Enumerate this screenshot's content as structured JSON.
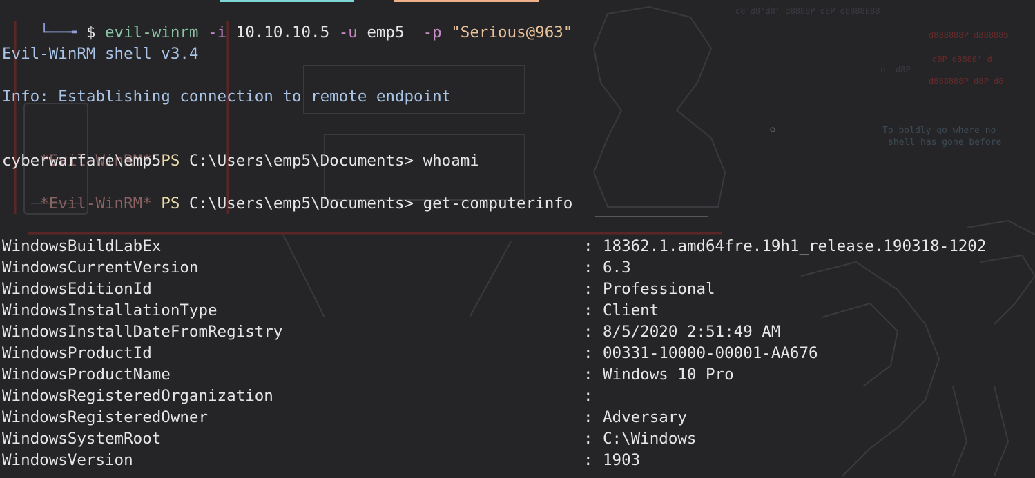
{
  "command_line": {
    "prompt_art": "└──╼",
    "dollar": "$",
    "program": "evil-winrm",
    "flag_i": "-i",
    "ip": "10.10.10.5",
    "flag_u": "-u",
    "user": "emp5",
    "flag_p": "-p",
    "password": "\"Serious@963\""
  },
  "banner": "Evil-WinRM shell v3.4",
  "info": "Info: Establishing connection to remote endpoint",
  "session": [
    {
      "prompt_tag": "*Evil-WinRM*",
      "ps": "PS",
      "path": "C:\\Users\\emp5\\Documents>",
      "command": "whoami"
    },
    {
      "prompt_tag": "*Evil-WinRM*",
      "ps": "PS",
      "path": "C:\\Users\\emp5\\Documents>",
      "command": "get-computerinfo"
    }
  ],
  "whoami_output": "cyberwarfare\\emp5",
  "computer_info": [
    {
      "key": "WindowsBuildLabEx",
      "value": "18362.1.amd64fre.19h1_release.190318-1202"
    },
    {
      "key": "WindowsCurrentVersion",
      "value": "6.3"
    },
    {
      "key": "WindowsEditionId",
      "value": "Professional"
    },
    {
      "key": "WindowsInstallationType",
      "value": "Client"
    },
    {
      "key": "WindowsInstallDateFromRegistry",
      "value": "8/5/2020 2:51:49 AM"
    },
    {
      "key": "WindowsProductId",
      "value": "00331-10000-00001-AA676"
    },
    {
      "key": "WindowsProductName",
      "value": "Windows 10 Pro"
    },
    {
      "key": "WindowsRegisteredOrganization",
      "value": ""
    },
    {
      "key": "WindowsRegisteredOwner",
      "value": "Adversary"
    },
    {
      "key": "WindowsSystemRoot",
      "value": "C:\\Windows"
    },
    {
      "key": "WindowsVersion",
      "value": "1903"
    }
  ],
  "kv_separator": ":",
  "wallpaper": {
    "quote_line1": "To boldly go where no",
    "quote_line2": "shell has gone before",
    "colors": {
      "art": "#3a3a3e",
      "red": "#6a2a2a",
      "quote": "#3c4a55"
    }
  }
}
